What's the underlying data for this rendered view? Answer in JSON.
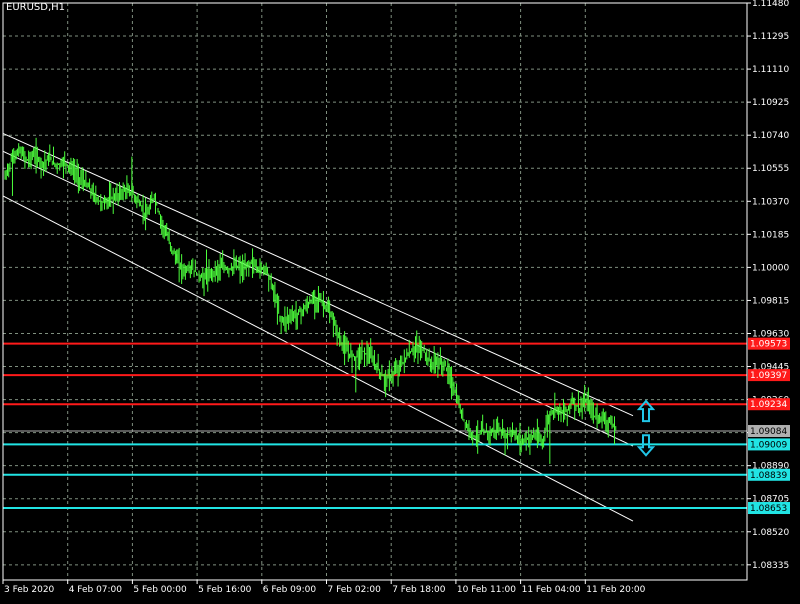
{
  "window": {
    "symbol_label": "EURUSD,H1"
  },
  "colors": {
    "background": "#000000",
    "grid": "#7f8f7f",
    "frame": "#ffffff",
    "candle": "#4cff3c",
    "channel": "#ffffff",
    "resistance": "#ff1a1a",
    "support": "#21e4e4",
    "current_price": "#b0b0b0",
    "arrow": "#21c6e8",
    "axis_text": "#ffffff"
  },
  "chart_data": {
    "type": "line",
    "series": [
      {
        "values": [
          1.105,
          1.1062,
          1.1065,
          1.106,
          1.1063,
          1.1058,
          1.1061,
          1.1057,
          1.1059,
          1.1055,
          1.105,
          1.1046,
          1.104,
          1.1036,
          1.1038,
          1.104,
          1.1043,
          1.1042,
          1.1036,
          1.1028,
          1.104,
          1.1025,
          1.1015,
          1.1004,
          1.0998,
          1.1,
          1.0995,
          1.0993,
          1.0998,
          1.1,
          1.0999,
          1.1001,
          1.0998,
          1.1003,
          1.0999,
          1.1,
          1.0987,
          1.097,
          1.0972,
          1.0974,
          1.0976,
          1.0981,
          1.0983,
          1.0978,
          1.097,
          1.0958,
          1.0952,
          1.095,
          1.0953,
          1.095,
          1.0943,
          1.0937,
          1.094,
          1.0945,
          1.0951,
          1.0955,
          1.0954,
          1.0946,
          1.0947,
          1.0945,
          1.0935,
          1.092,
          1.091,
          1.0905,
          1.0908,
          1.0907,
          1.091,
          1.0905,
          1.0908,
          1.0903,
          1.0904,
          1.0906,
          1.0902,
          1.0918,
          1.0922,
          1.0918,
          1.0925,
          1.0921,
          1.0925,
          1.0917,
          1.0916,
          1.0913,
          1.0909
        ]
      }
    ],
    "y_ticks": [
      "1.11480",
      "1.11295",
      "1.11110",
      "1.10925",
      "1.10740",
      "1.10555",
      "1.10370",
      "1.10185",
      "1.10000",
      "1.09815",
      "1.09630",
      "1.09445",
      "1.09260",
      "1.09075",
      "1.08890",
      "1.08705",
      "1.08520",
      "1.08335"
    ],
    "x_ticks": [
      "3 Feb 2020",
      "4 Feb 07:00",
      "5 Feb 00:00",
      "5 Feb 16:00",
      "6 Feb 09:00",
      "7 Feb 02:00",
      "7 Feb 18:00",
      "10 Feb 11:00",
      "11 Feb 04:00",
      "11 Feb 20:00"
    ],
    "ylim": [
      1.0825,
      1.1148
    ],
    "grid": true,
    "horizontal_levels": [
      {
        "price": 1.09573,
        "label": "1.09573",
        "kind": "resistance"
      },
      {
        "price": 1.09397,
        "label": "1.09397",
        "kind": "resistance"
      },
      {
        "price": 1.09234,
        "label": "1.09234",
        "kind": "resistance"
      },
      {
        "price": 1.09009,
        "label": "1.09009",
        "kind": "support"
      },
      {
        "price": 1.08839,
        "label": "1.08839",
        "kind": "support"
      },
      {
        "price": 1.08653,
        "label": "1.08653",
        "kind": "support"
      }
    ],
    "current_price": {
      "price": 1.09084,
      "label": "1.09084"
    },
    "channel": {
      "upper": {
        "from": 1.1075,
        "to": 1.0917
      },
      "middle": {
        "from": 1.1065,
        "to": 1.09
      },
      "lower": {
        "from": 1.104,
        "to": 1.0858
      }
    },
    "arrows": [
      {
        "direction": "up",
        "price": 1.0919
      },
      {
        "direction": "down",
        "price": 1.0901
      }
    ]
  }
}
